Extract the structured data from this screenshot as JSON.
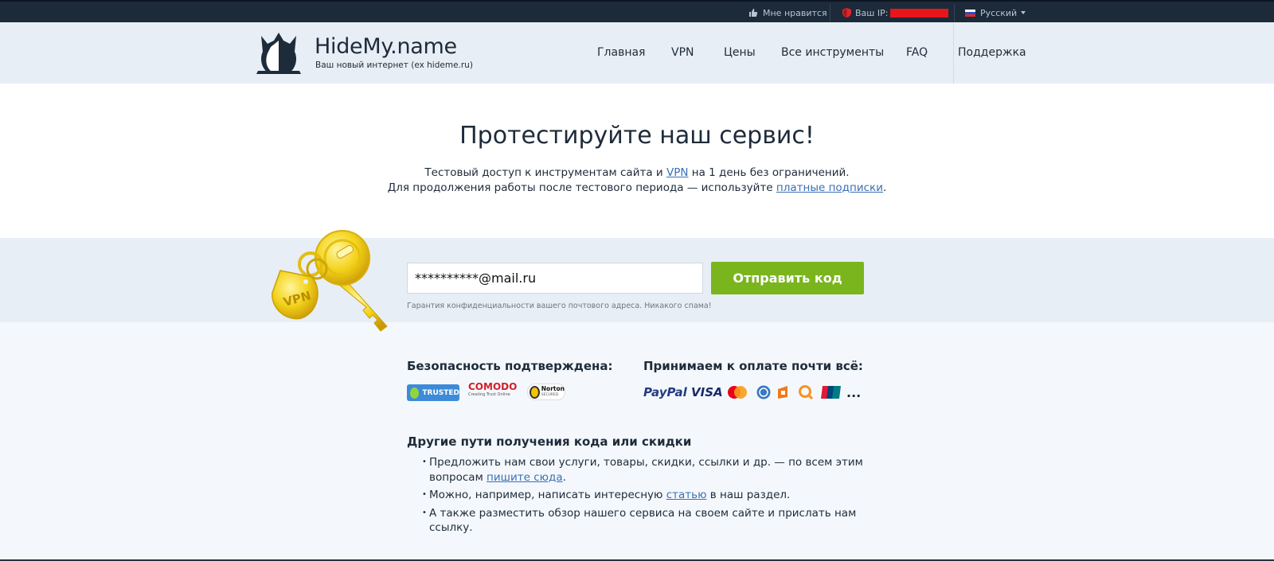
{
  "topbar": {
    "like_label": "Мне нравится",
    "ip_label": "Ваш IP:",
    "language": "Русский"
  },
  "header": {
    "logo_title": "HideMy.name",
    "logo_subtitle": "Ваш новый интернет (ex hideme.ru)",
    "nav": [
      {
        "label": "Главная"
      },
      {
        "label": "VPN"
      },
      {
        "label": "Цены"
      },
      {
        "label": "Все инструменты"
      },
      {
        "label": "FAQ"
      },
      {
        "label": "Поддержка"
      }
    ]
  },
  "hero": {
    "title": "Протестируйте наш сервис!",
    "line1_before": "Тестовый доступ к инструментам сайта и ",
    "line1_link": "VPN",
    "line1_after": " на 1 день без ограничений.",
    "line2_before": "Для продолжения работы после тестового периода — используйте ",
    "line2_link": "платные подписки",
    "line2_after": "."
  },
  "form": {
    "email_value": "**********@mail.ru",
    "send_label": "Отправить код",
    "privacy_note": "Гарантия конфиденциальности вашего почтового адреса. Никакого спама!",
    "key_tag": "VPN"
  },
  "security": {
    "title": "Безопасность подтверждена:",
    "badges": [
      "TRUSTED",
      "COMODO",
      "Creating Trust Online",
      "Norton",
      "SECURED"
    ]
  },
  "payment": {
    "title": "Принимаем к оплате почти всё:",
    "methods": [
      "PayPal",
      "VISA",
      "mastercard-icon",
      "webmoney-icon",
      "yandex-money-icon",
      "qiwi-icon",
      "unionpay-icon"
    ],
    "more": "..."
  },
  "other": {
    "title": "Другие пути получения кода или скидки",
    "item1_before": "Предложить нам свои услуги, товары, скидки, ссылки и др. — по всем этим вопросам ",
    "item1_link": "пишите сюда",
    "item1_after": ".",
    "item2_before": "Можно, например, написать интересную ",
    "item2_link": "статью",
    "item2_after": " в наш раздел.",
    "item3": "А также разместить обзор нашего сервиса на своем сайте и прислать нам ссылку."
  },
  "colors": {
    "topbar_bg": "#1c2a3a",
    "header_bg": "#e8eef5",
    "accent_green": "#7ab51d",
    "link": "#3a6fb5",
    "ip_mask": "#e8151b"
  }
}
